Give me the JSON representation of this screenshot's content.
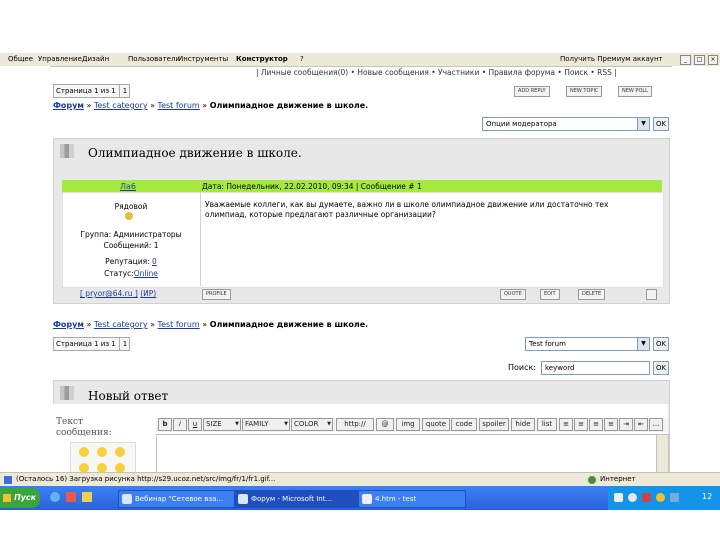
{
  "menubar": {
    "items": [
      "Общее",
      "Управление",
      "Дизайн",
      "Пользователи",
      "Инструменты",
      "Конструктор",
      "?"
    ],
    "premium": "Получить Премиум аккаунт"
  },
  "top_links": "| Личные сообщения(0) • Новые сообщения • Участники • Правила форума • Поиск • RSS |",
  "pager_top": {
    "label": "Страница 1 из 1",
    "page": "1"
  },
  "buttons": {
    "add_reply": "ADD REPLY",
    "new_topic": "NEW TOPIC",
    "new_poll": "NEW POLL"
  },
  "breadcrumb": {
    "forum": "Форум",
    "category": "Test category",
    "subforum": "Test forum",
    "topic": "Олимпиадное движение в школе.",
    "sep": " » "
  },
  "moderator_select": {
    "value": "Опции модератора",
    "go": "OK"
  },
  "topic_title": "Олимпиадное движение в школе.",
  "post": {
    "author": "Ла6",
    "header": "Дата: Понедельник, 22.02.2010, 09:34 | Сообщение # 1",
    "rank": "Рядовой",
    "group": "Группа: Администраторы",
    "messages": "Сообщений: 1",
    "reputation_label": "Репутация:",
    "reputation_value": "0",
    "status_label": "Статус:",
    "status_value": "Online",
    "ip": "[ pryor@64.ru ]",
    "ip_link": "(ИР)",
    "body": "Уважаемые коллеги, как вы думаете, важно ли в школе олимпиадное движение или достаточно тех олимпиад, которые предлагают различные организации?",
    "profile_btn": "PROFILE",
    "quote_btn": "QUOTE",
    "edit_btn": "EDIT",
    "delete_btn": "DELETE"
  },
  "pager_bottom": {
    "label": "Страница 1 из 1",
    "page": "1"
  },
  "forum_select": {
    "value": "Test forum",
    "go": "OK"
  },
  "search": {
    "label": "Поиск:",
    "value": "keyword",
    "go": "OK"
  },
  "reply": {
    "title": "Новый ответ",
    "text_label": "Текст сообщения:",
    "toolbar": [
      "b",
      "i",
      "u",
      "SIZE",
      "FAMILY",
      "COLOR",
      "http://",
      "@",
      "img",
      "quote",
      "code",
      "spoiler",
      "hide",
      "list"
    ]
  },
  "statusbar": {
    "text": "(Осталось 16) Загрузка рисунка http://s29.ucoz.net/src/img/fr/1/fr1.gif...",
    "zone": "Интернет"
  },
  "taskbar": {
    "start": "Пуск",
    "tasks": [
      "Вебинар \"Сетевое вза...",
      "Форум - Microsoft Int...",
      "4.htm - test"
    ],
    "clock": "12"
  },
  "colors": {
    "accent_green": "#a5e840",
    "link": "#1a3d9c",
    "taskbar": "#2a60d8"
  }
}
